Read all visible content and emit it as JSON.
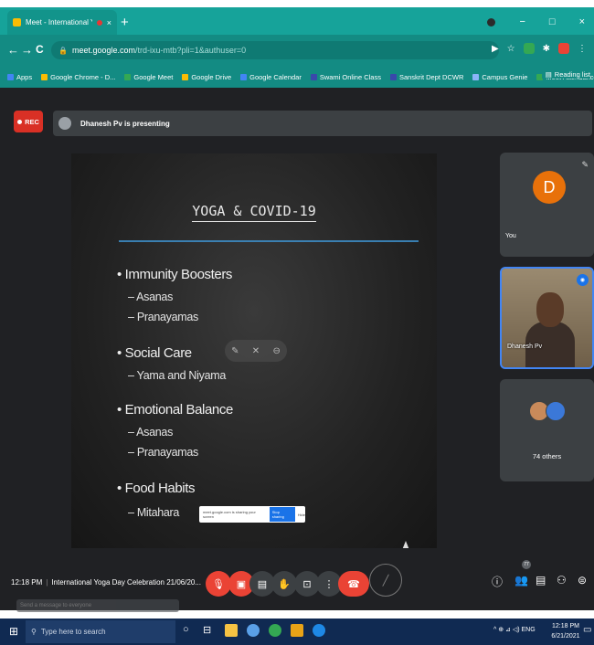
{
  "browser": {
    "tab_title": "Meet - International Yoga D...",
    "tab_close": "×",
    "new_tab": "+",
    "url_host": "meet.google.com",
    "url_path": "/trd-ixu-mtb?pli=1&authuser=0",
    "back": "←",
    "forward": "→",
    "reload": "C",
    "minimize": "−",
    "maximize": "□",
    "close": "×"
  },
  "bookmarks": {
    "items": [
      "Apps",
      "Google Chrome - D...",
      "Google Meet",
      "Google Drive",
      "Google Calendar",
      "Swami Online Class",
      "Sanskrit Dept DCWR",
      "Campus Genie",
      "Meet Attendance"
    ],
    "colors": [
      "#4285f4",
      "#fbbc04",
      "#34a853",
      "#fbbc04",
      "#4285f4",
      "#3949ab",
      "#3949ab",
      "#8ab4f8",
      "#34a853"
    ],
    "reading_list": "Reading list"
  },
  "meet": {
    "rec_label": "REC",
    "presenting_text": "Dhanesh Pv is presenting",
    "slide": {
      "title": "YOGA & COVID-19",
      "bullets": [
        {
          "text": "• Immunity Boosters",
          "subs": [
            "– Asanas",
            "– Pranayamas"
          ]
        },
        {
          "text": "• Social Care",
          "subs": [
            "– Yama and Niyama"
          ]
        },
        {
          "text": "• Emotional Balance",
          "subs": [
            "– Asanas",
            "– Pranayamas"
          ]
        },
        {
          "text": "• Food Habits",
          "subs": [
            "– Mitahara"
          ]
        }
      ],
      "snackbar_text": "meet.google.com is sharing your screen",
      "snackbar_button": "Stop sharing",
      "snackbar_hide": "Hide"
    },
    "participants": {
      "you_initial": "D",
      "you_label": "You",
      "presenter_name": "Dhanesh Pv",
      "others_label": "74 others"
    },
    "bottom": {
      "time": "12:18 PM",
      "meeting_title": "International Yoga Day Celebration 21/06/20...",
      "participant_count": "77",
      "chat_placeholder": "Send a message to everyone"
    }
  },
  "taskbar": {
    "search_placeholder": "Type here to search",
    "tray_text": "^  ⊕  ⊿  ◁)  ENG",
    "time": "12:18 PM",
    "date": "6/21/2021"
  },
  "colors": {
    "chrome_teal": "#16a39a",
    "meet_bg": "#202124",
    "end_call_red": "#ea4335",
    "avatar_orange": "#e8710a",
    "taskbar": "#102a52"
  }
}
